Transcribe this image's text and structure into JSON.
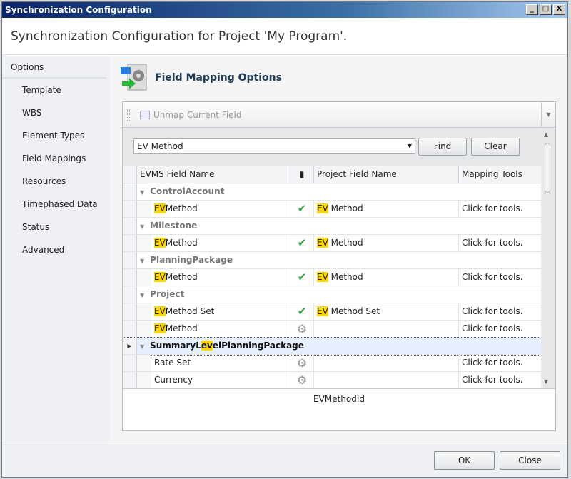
{
  "window": {
    "title": "Synchronization Configuration",
    "min": "_",
    "max": "□",
    "close": "X"
  },
  "header": {
    "title": "Synchronization Configuration for Project 'My Program'."
  },
  "sidebar": {
    "section": "Options",
    "items": [
      "Template",
      "WBS",
      "Element Types",
      "Field Mappings",
      "Resources",
      "Timephased Data",
      "Status",
      "Advanced"
    ]
  },
  "main": {
    "title": "Field Mapping Options"
  },
  "toolbar": {
    "unmap_label": "Unmap Current Field"
  },
  "search": {
    "value": "EV Method",
    "find": "Find",
    "clear": "Clear"
  },
  "grid": {
    "columns": [
      "EVMS Field Name",
      "Project Field Name",
      "Mapping Tools"
    ],
    "rows": [
      {
        "type": "group",
        "pre": "",
        "hl": "",
        "post": "ControlAccount"
      },
      {
        "type": "item",
        "name": [
          "",
          "EV",
          "Method"
        ],
        "status": "check",
        "project": [
          "",
          "EV",
          " Method"
        ],
        "tools": "Click for tools."
      },
      {
        "type": "group",
        "pre": "",
        "hl": "",
        "post": "Milestone"
      },
      {
        "type": "item",
        "name": [
          "",
          "EV",
          "Method"
        ],
        "status": "check",
        "project": [
          "",
          "EV",
          " Method"
        ],
        "tools": "Click for tools."
      },
      {
        "type": "group",
        "pre": "",
        "hl": "",
        "post": "PlanningPackage"
      },
      {
        "type": "item",
        "name": [
          "",
          "EV",
          "Method"
        ],
        "status": "check",
        "project": [
          "",
          "EV",
          " Method"
        ],
        "tools": "Click for tools."
      },
      {
        "type": "group",
        "pre": "",
        "hl": "",
        "post": "Project"
      },
      {
        "type": "item",
        "name": [
          "",
          "EV",
          "Method Set"
        ],
        "status": "check",
        "project": [
          "",
          "EV",
          " Method Set"
        ],
        "tools": "Click for tools."
      },
      {
        "type": "item",
        "name": [
          "",
          "EV",
          "Method"
        ],
        "status": "gear",
        "project": [
          "",
          "",
          ""
        ],
        "tools": "Click for tools."
      },
      {
        "type": "group",
        "selected": true,
        "pre": "SummaryL",
        "hl": "ev",
        "post": "elPlanningPackage"
      },
      {
        "type": "item",
        "name": [
          "",
          "",
          "Rate Set"
        ],
        "status": "gear",
        "project": [
          "",
          "",
          ""
        ],
        "tools": "Click for tools."
      },
      {
        "type": "item",
        "name": [
          "",
          "",
          "Currency"
        ],
        "status": "gear",
        "project": [
          "",
          "",
          ""
        ],
        "tools": "Click for tools."
      },
      {
        "type": "item",
        "name": [
          "",
          "",
          ""
        ],
        "status": "gear",
        "project": [
          "",
          "",
          ""
        ],
        "tools": ""
      }
    ],
    "footer": "EVMethodId"
  },
  "buttons": {
    "ok": "OK",
    "close": "Close"
  }
}
